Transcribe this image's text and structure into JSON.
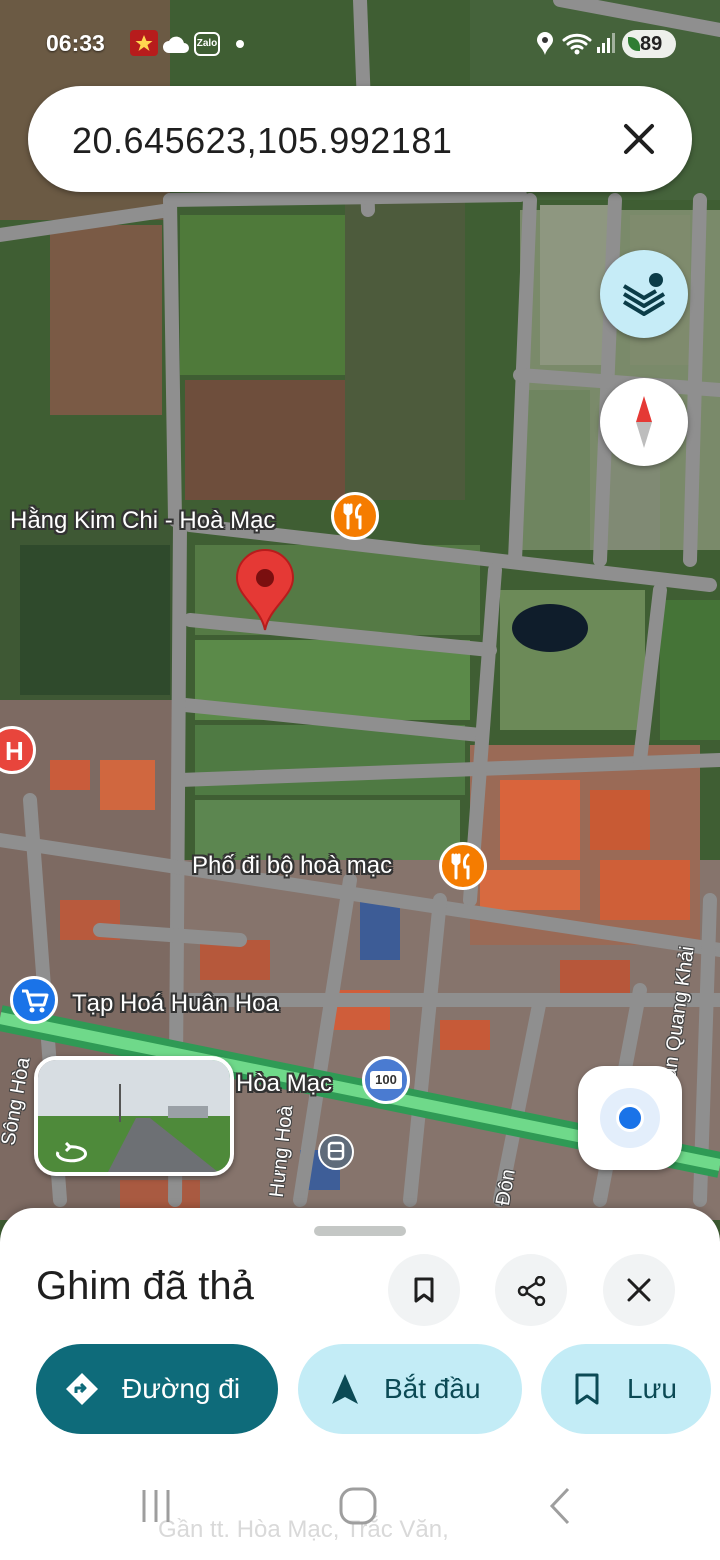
{
  "status_bar": {
    "time": "06:33",
    "battery": "89",
    "icons": [
      "app-notification-icon",
      "cloud-icon",
      "zalo-icon",
      "dot-icon",
      "location-icon",
      "wifi-icon",
      "signal-icon",
      "battery-icon"
    ],
    "zalo_label": "Zalo"
  },
  "search": {
    "query": "20.645623,105.992181",
    "clear_icon": "close-icon"
  },
  "map": {
    "labels": {
      "hang_kim_chi": "Hằng Kim Chi - Hoà Mạc",
      "pho_di_bo": "Phố đi bộ hoà mạc",
      "tap_hoa": "Tạp Hoá Huân Hoa",
      "hoa_mac": "Hòa Mạc",
      "tran_quang_khai": "Trần Quang Khải",
      "song_hoa": "Sông Hòa",
      "hung_hoa": "Hưng Hoà",
      "don": "Đôn",
      "hospital_letter": "H",
      "route_shield": "100"
    },
    "colors": {
      "pin": "#e53935",
      "restaurant": "#f57c00",
      "hospital": "#e8453c",
      "shop": "#1a73e8",
      "highway": "#3cb371"
    }
  },
  "sheet": {
    "title": "Ghim đã thả",
    "directions_label": "Đường đi",
    "start_label": "Bắt đầu",
    "save_label": "Lưu",
    "address_preview": "Gần tt. Hòa Mạc, Trắc Văn,",
    "accent_color": "#0e6b7a"
  }
}
